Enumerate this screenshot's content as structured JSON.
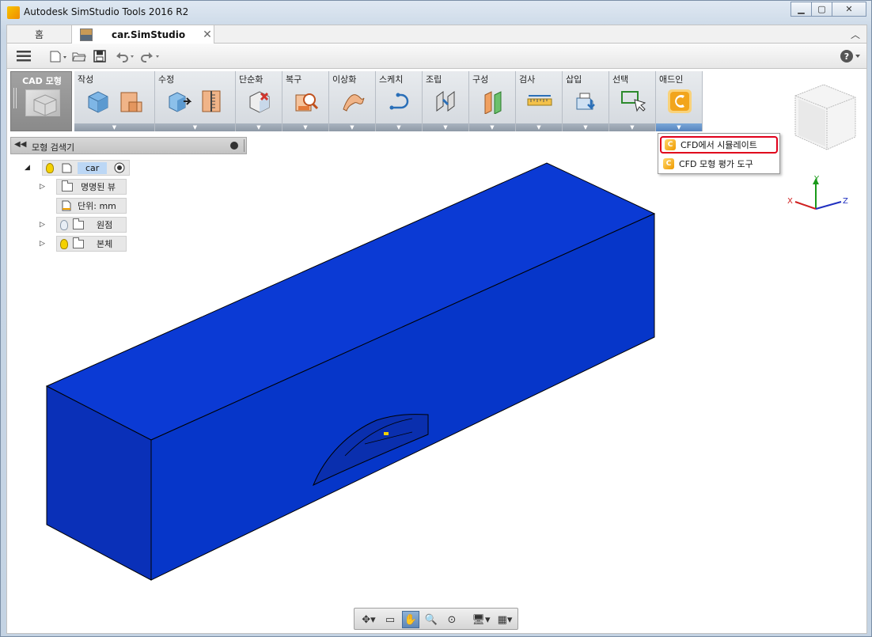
{
  "window": {
    "title": "Autodesk SimStudio Tools 2016 R2"
  },
  "tabs": [
    {
      "label": "홈"
    },
    {
      "label": "car.SimStudio"
    }
  ],
  "ribbon": {
    "mode_label": "CAD 모형",
    "groups": [
      {
        "label": "작성"
      },
      {
        "label": "수정"
      },
      {
        "label": "단순화"
      },
      {
        "label": "복구"
      },
      {
        "label": "이상화"
      },
      {
        "label": "스케치"
      },
      {
        "label": "조립"
      },
      {
        "label": "구성"
      },
      {
        "label": "검사"
      },
      {
        "label": "삽입"
      },
      {
        "label": "선택"
      },
      {
        "label": "애드인"
      }
    ]
  },
  "addin_menu": {
    "items": [
      {
        "label": "CFD에서 시뮬레이트"
      },
      {
        "label": "CFD 모형 평가 도구"
      }
    ],
    "highlighted_index": 0
  },
  "browser": {
    "title": "모형 검색기",
    "root": {
      "label": "car"
    },
    "items": [
      {
        "label": "명명된 뷰"
      },
      {
        "label": "단위: mm"
      },
      {
        "label": "원점"
      },
      {
        "label": "본체"
      }
    ]
  },
  "viewport": {
    "model_color": "#0a34c9",
    "axes": {
      "x": "X",
      "y": "Y",
      "z": "Z"
    }
  },
  "colors": {
    "accent": "#5583be",
    "highlight": "#e0001b"
  }
}
